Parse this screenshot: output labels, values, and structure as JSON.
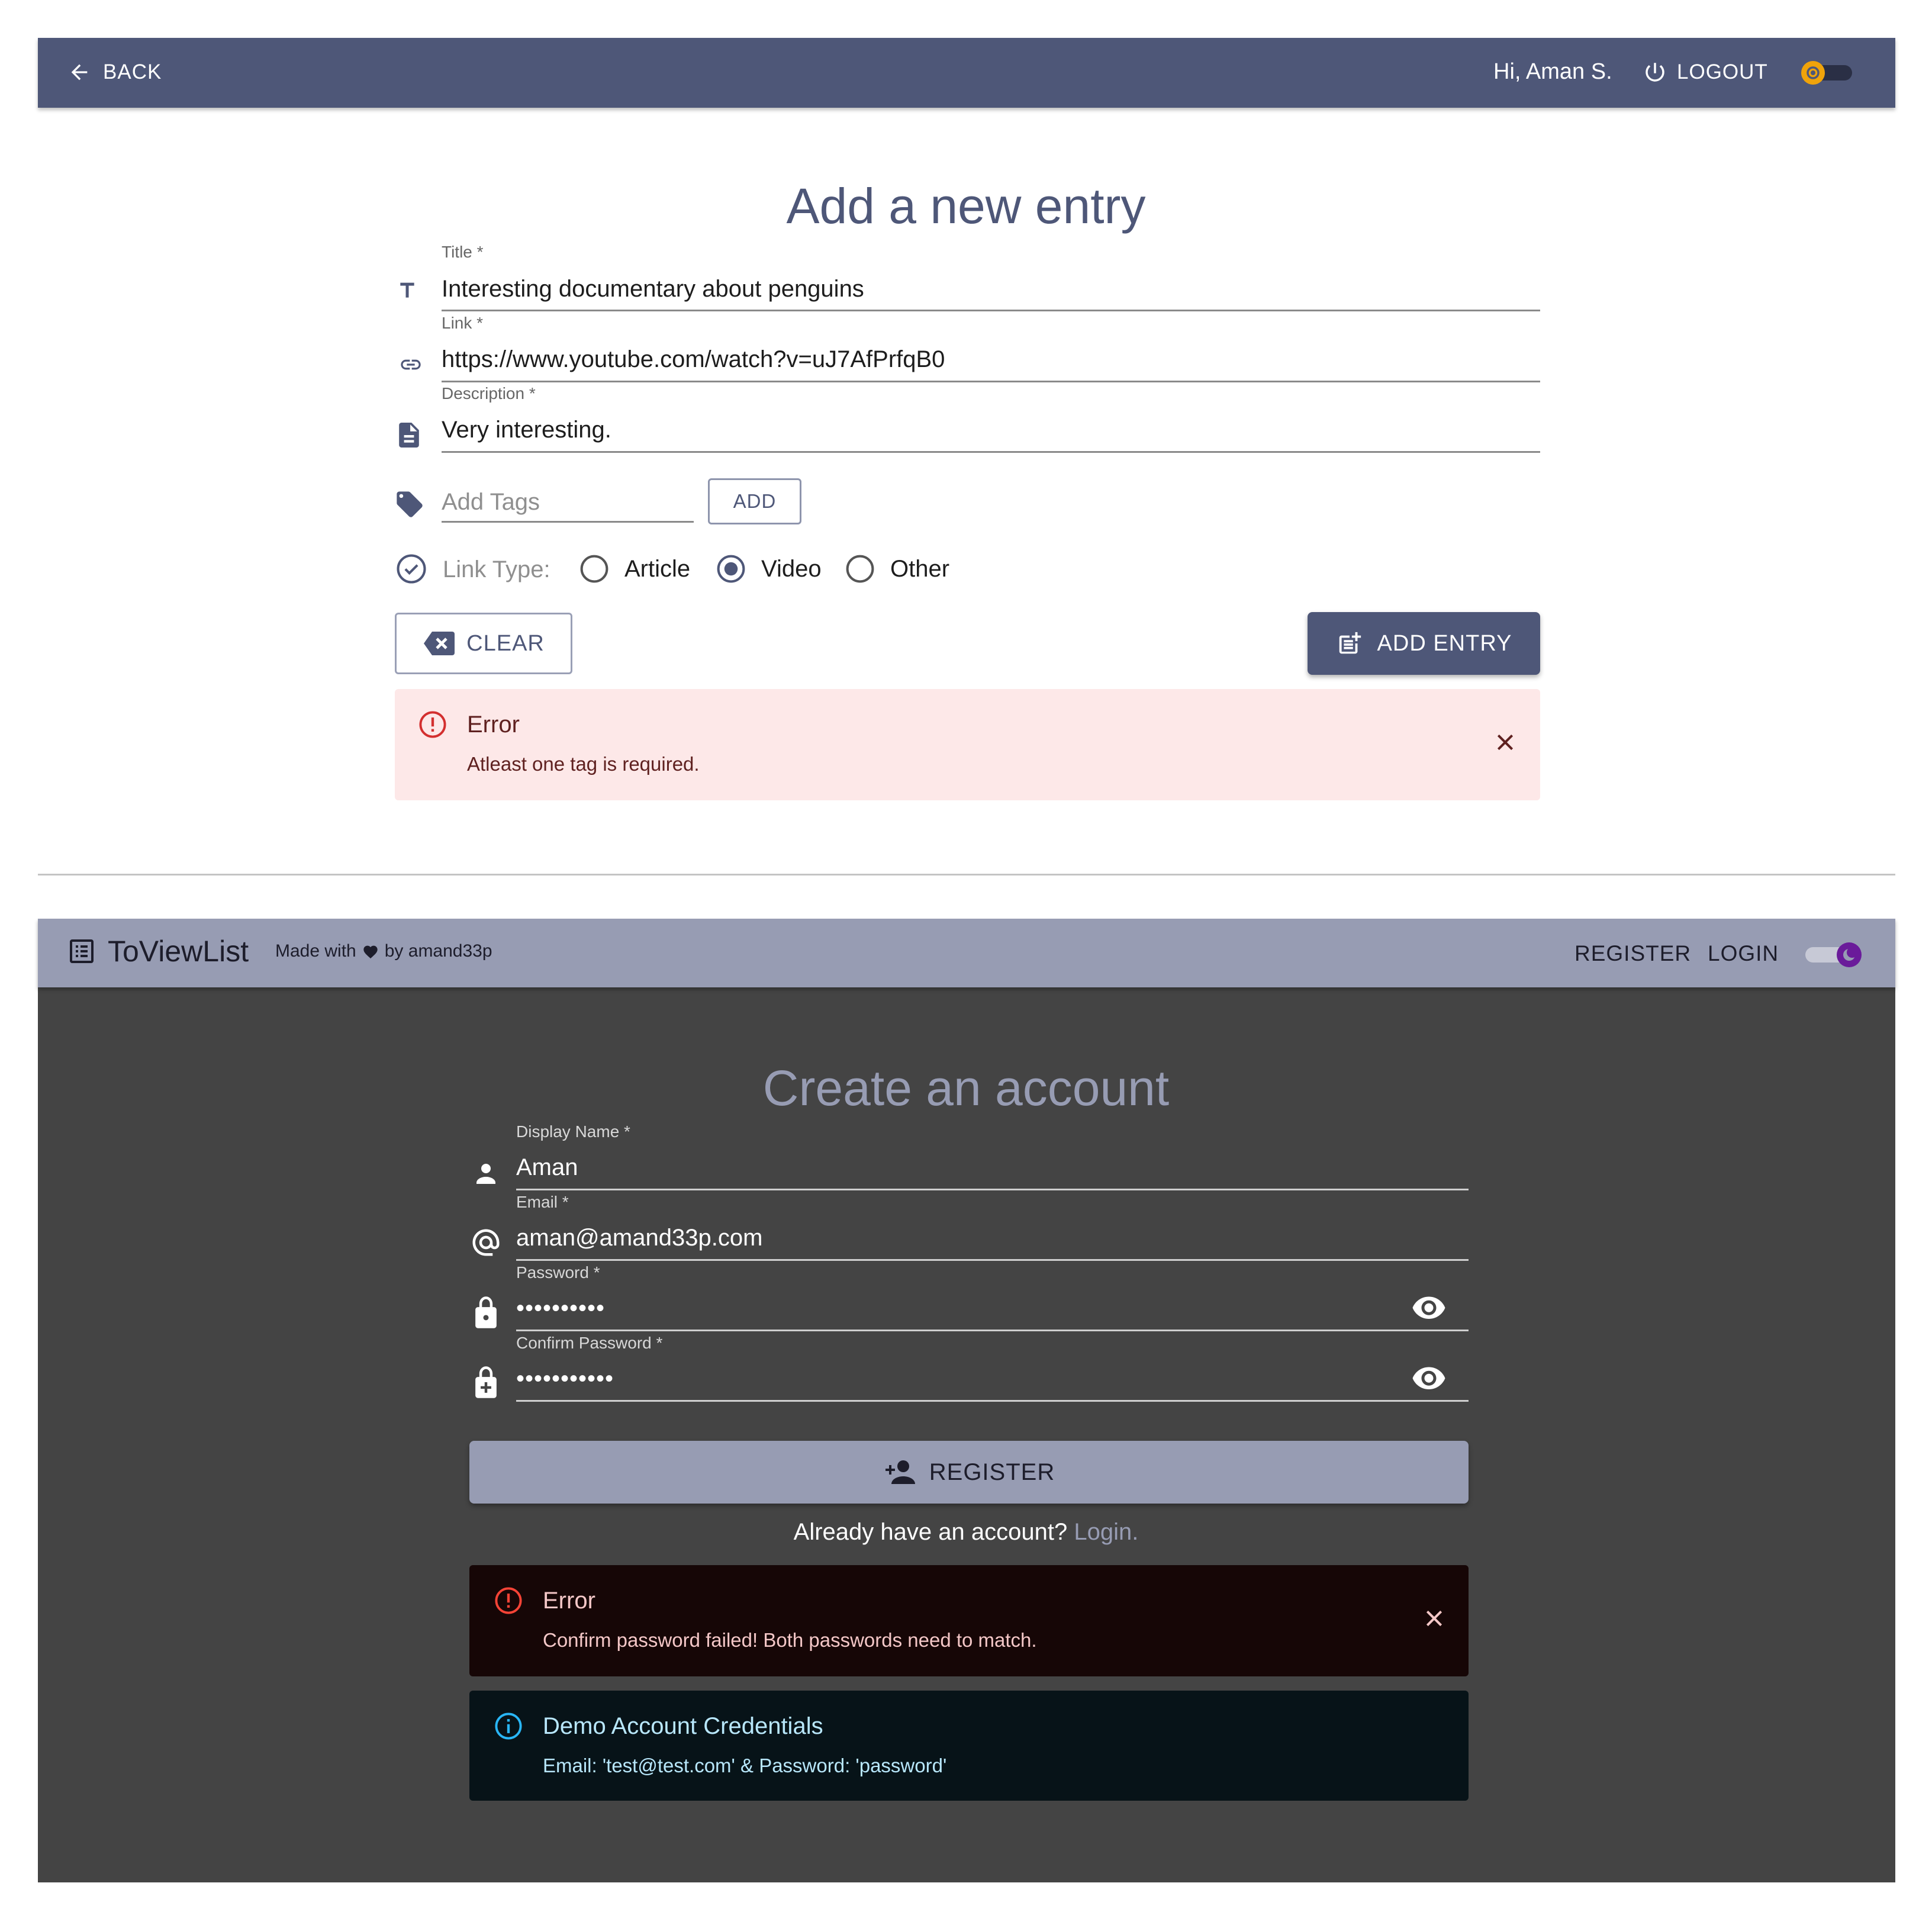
{
  "entry_form": {
    "topbar": {
      "back_label": "BACK",
      "greeting": "Hi, Aman S.",
      "logout_label": "LOGOUT"
    },
    "heading": "Add a new entry",
    "fields": {
      "title": {
        "label": "Title *",
        "value": "Interesting documentary about penguins",
        "icon": "title-text-icon"
      },
      "link": {
        "label": "Link *",
        "value": "https://www.youtube.com/watch?v=uJ7AfPrfqB0",
        "icon": "link-icon"
      },
      "description": {
        "label": "Description *",
        "value": "Very interesting.",
        "icon": "document-icon"
      }
    },
    "tags": {
      "placeholder": "Add Tags",
      "add_button": "ADD",
      "icon": "tag-icon"
    },
    "link_type": {
      "label": "Link Type:",
      "options": [
        "Article",
        "Video",
        "Other"
      ],
      "selected": "Video"
    },
    "clear_button": "CLEAR",
    "add_entry_button": "ADD ENTRY",
    "error": {
      "title": "Error",
      "message": "Atleast one tag is required."
    }
  },
  "register_form": {
    "navbar": {
      "app_name": "ToViewList",
      "tagline_prefix": "Made with",
      "tagline_suffix": "by amand33p",
      "register_label": "REGISTER",
      "login_label": "LOGIN"
    },
    "heading": "Create an account",
    "fields": {
      "display_name": {
        "label": "Display Name *",
        "value": "Aman",
        "icon": "person-icon"
      },
      "email": {
        "label": "Email *",
        "value": "aman@amand33p.com",
        "icon": "at-sign-icon"
      },
      "password": {
        "label": "Password *",
        "value": "••••••••••",
        "icon": "lock-icon"
      },
      "confirm_password": {
        "label": "Confirm Password *",
        "value": "•••••••••••",
        "icon": "lock-plus-icon"
      }
    },
    "register_button": "REGISTER",
    "already_text": "Already have an account?",
    "login_link": "Login.",
    "error": {
      "title": "Error",
      "message": "Confirm password failed! Both passwords need to match."
    },
    "info": {
      "title": "Demo Account Credentials",
      "message": "Email: 'test@test.com' & Password: 'password'"
    }
  },
  "colors": {
    "primary": "#4e5778",
    "primary_light": "#979cb3",
    "dark_bg": "#444444",
    "error_light_bg": "#fde8e8",
    "error_dark_bg": "#160606",
    "info_dark_bg": "#071318",
    "sun_accent": "#f0a30a",
    "moon_accent": "#6a1b9a"
  }
}
